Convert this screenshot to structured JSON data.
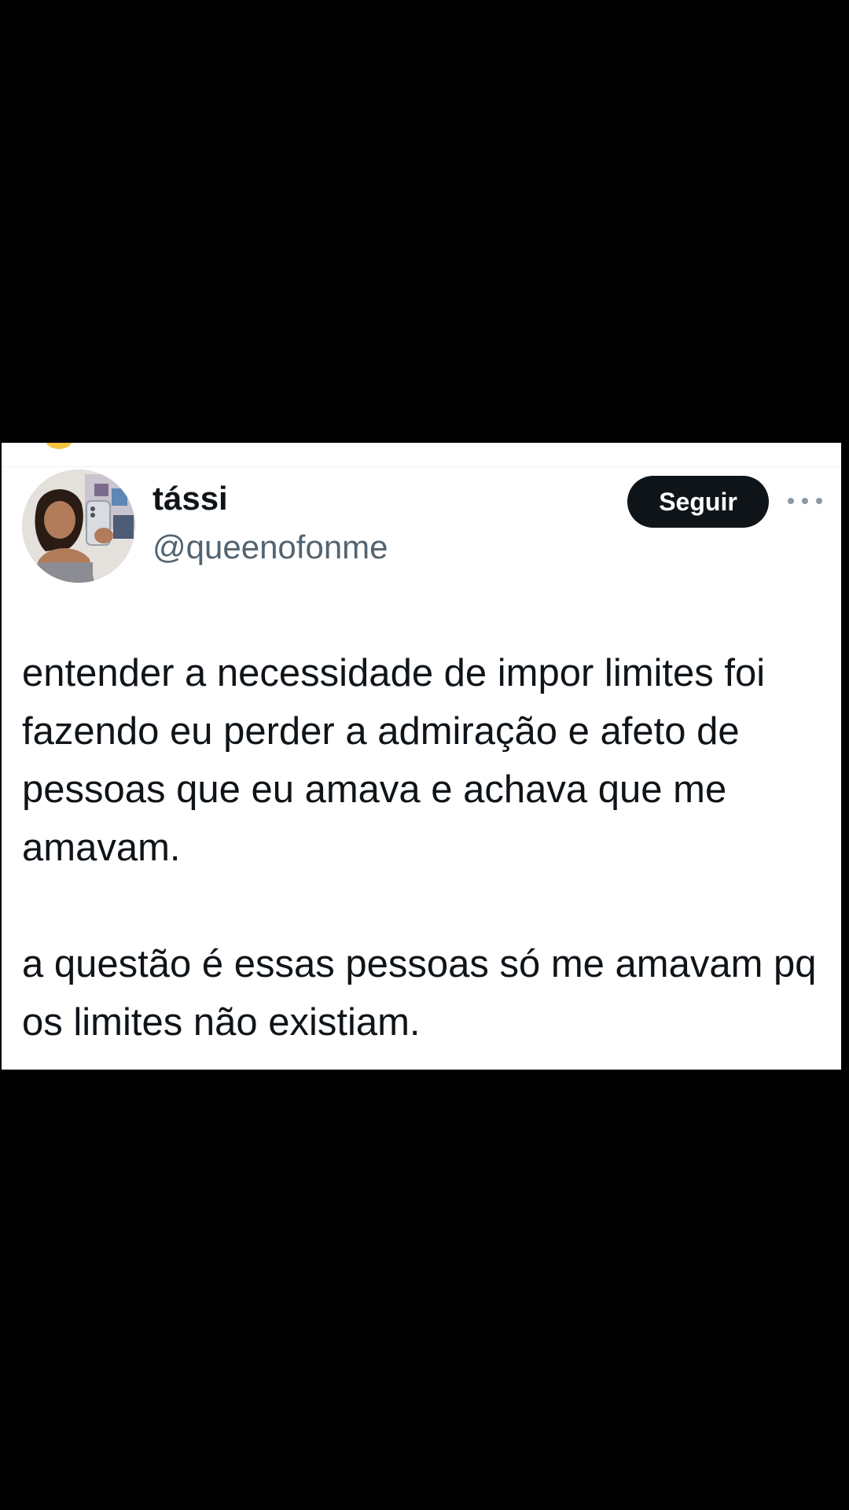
{
  "author": {
    "display_name": "tássi",
    "handle": "@queenofonme"
  },
  "follow_button_label": "Seguir",
  "more_options_icon": "more-horizontal-icon",
  "tweet": {
    "paragraphs": [
      "entender a necessidade de impor limites foi fazendo eu perder a admiração e afeto de pessoas que eu amava e achava que me amavam.",
      "a questão é essas pessoas só me amavam pq os limites não existiam."
    ]
  },
  "colors": {
    "background": "#000000",
    "card": "#ffffff",
    "text_primary": "#0f1419",
    "text_secondary": "#536471",
    "button": "#0f1419"
  }
}
